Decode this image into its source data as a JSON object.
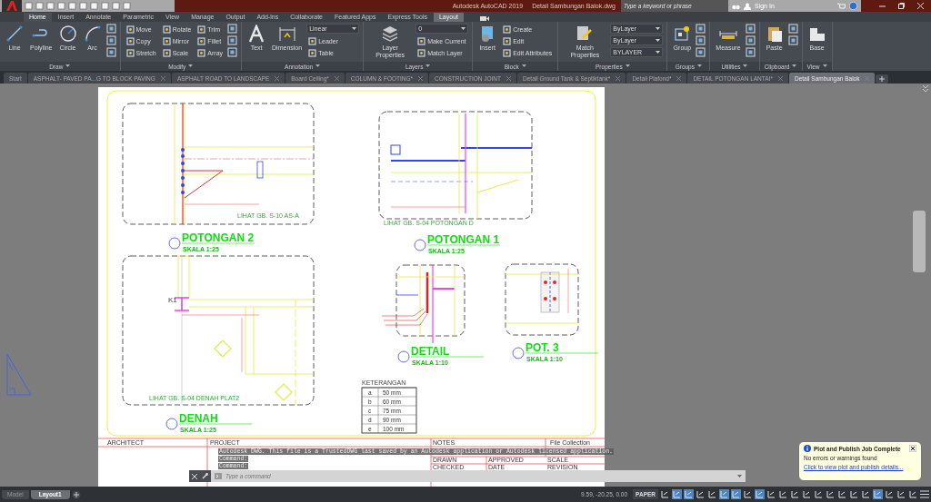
{
  "window": {
    "app_name": "Autodesk AutoCAD 2019",
    "file_name": "Detail Sambungan Balok.dwg"
  },
  "search": {
    "placeholder": "Type a keyword or phrase"
  },
  "account": {
    "label": "Sign In"
  },
  "ribbon_tabs": [
    {
      "label": "Home",
      "selected": true,
      "kind": "normal"
    },
    {
      "label": "Insert",
      "selected": false,
      "kind": "normal"
    },
    {
      "label": "Annotate",
      "selected": false,
      "kind": "normal"
    },
    {
      "label": "Parametric",
      "selected": false,
      "kind": "normal"
    },
    {
      "label": "View",
      "selected": false,
      "kind": "normal"
    },
    {
      "label": "Manage",
      "selected": false,
      "kind": "normal"
    },
    {
      "label": "Output",
      "selected": false,
      "kind": "normal"
    },
    {
      "label": "Add-ins",
      "selected": false,
      "kind": "normal"
    },
    {
      "label": "Collaborate",
      "selected": false,
      "kind": "normal"
    },
    {
      "label": "Featured Apps",
      "selected": false,
      "kind": "normal"
    },
    {
      "label": "Express Tools",
      "selected": false,
      "kind": "normal"
    },
    {
      "label": "Layout",
      "selected": false,
      "kind": "contextual"
    }
  ],
  "panels": [
    {
      "title": "Draw",
      "tools": [
        {
          "kind": "large",
          "label": "Line"
        },
        {
          "kind": "large",
          "label": "Polyline"
        },
        {
          "kind": "large",
          "label": "Circle"
        },
        {
          "kind": "large",
          "label": "Arc"
        },
        {
          "kind": "icon"
        },
        {
          "kind": "icon"
        },
        {
          "kind": "icon"
        }
      ]
    },
    {
      "title": "Modify",
      "tools": [
        {
          "kind": "small",
          "label": "Move"
        },
        {
          "kind": "small",
          "label": "Copy"
        },
        {
          "kind": "small",
          "label": "Stretch"
        },
        {
          "kind": "small",
          "label": "Rotate"
        },
        {
          "kind": "small",
          "label": "Mirror"
        },
        {
          "kind": "small",
          "label": "Scale"
        },
        {
          "kind": "small",
          "label": "Trim"
        },
        {
          "kind": "small",
          "label": "Fillet"
        },
        {
          "kind": "small",
          "label": "Array"
        },
        {
          "kind": "icon"
        },
        {
          "kind": "icon"
        },
        {
          "kind": "icon"
        }
      ]
    },
    {
      "title": "Annotation",
      "tools": [
        {
          "kind": "large",
          "label": "Text"
        },
        {
          "kind": "large",
          "label": "Dimension"
        },
        {
          "kind": "select",
          "label": "Linear"
        },
        {
          "kind": "small",
          "label": "Leader"
        },
        {
          "kind": "small",
          "label": "Table"
        }
      ]
    },
    {
      "title": "Layers",
      "tools": [
        {
          "kind": "large",
          "label": "Layer Properties"
        },
        {
          "kind": "select",
          "label": "0"
        },
        {
          "kind": "small",
          "label": "Make Current"
        },
        {
          "kind": "small",
          "label": "Match Layer"
        }
      ]
    },
    {
      "title": "Block",
      "tools": [
        {
          "kind": "large",
          "label": "Insert"
        },
        {
          "kind": "small",
          "label": "Create"
        },
        {
          "kind": "small",
          "label": "Edit"
        },
        {
          "kind": "small",
          "label": "Edit Attributes"
        }
      ]
    },
    {
      "title": "Properties",
      "tools": [
        {
          "kind": "large",
          "label": "Match Properties"
        },
        {
          "kind": "select",
          "label": "ByLayer"
        },
        {
          "kind": "select",
          "label": "ByLayer"
        },
        {
          "kind": "select",
          "label": "BYLAYER"
        }
      ]
    },
    {
      "title": "Groups",
      "tools": [
        {
          "kind": "large",
          "label": "Group"
        },
        {
          "kind": "icon"
        },
        {
          "kind": "icon"
        },
        {
          "kind": "icon"
        }
      ]
    },
    {
      "title": "Utilities",
      "tools": [
        {
          "kind": "large",
          "label": "Measure"
        },
        {
          "kind": "icon"
        },
        {
          "kind": "icon"
        },
        {
          "kind": "icon"
        }
      ]
    },
    {
      "title": "Clipboard",
      "tools": [
        {
          "kind": "large",
          "label": "Paste"
        },
        {
          "kind": "icon"
        },
        {
          "kind": "icon"
        }
      ]
    },
    {
      "title": "View",
      "tools": [
        {
          "kind": "large",
          "label": "Base"
        }
      ]
    }
  ],
  "file_tabs": [
    {
      "label": "Start",
      "selected": false
    },
    {
      "label": "ASPHALT- PAVED PA...G TO BLOCK PAVING",
      "selected": false
    },
    {
      "label": "ASPHALT ROAD TO LANDSCAPE",
      "selected": false
    },
    {
      "label": "Board Ceiling*",
      "selected": false
    },
    {
      "label": "COLUMN & FOOTING*",
      "selected": false
    },
    {
      "label": "CONSTRUCTION JOINT",
      "selected": false
    },
    {
      "label": "Detail Ground Tank & Septiktank*",
      "selected": false
    },
    {
      "label": "Detail Plafond*",
      "selected": false
    },
    {
      "label": "DETAIL POTONGAN LANTAI*",
      "selected": false
    },
    {
      "label": "Detail Sambungan Balok",
      "selected": true
    }
  ],
  "sheet": {
    "views": [
      {
        "title": "POTONGAN 2",
        "scale": "SKALA 1:25",
        "note": "LIHAT GB. S-10  AS-A"
      },
      {
        "title": "POTONGAN 1",
        "scale": "SKALA 1:25",
        "note": "LIHAT GB. S-04  POTONGAN D"
      },
      {
        "title": "DENAH",
        "scale": "SKALA 1:25",
        "note": "LIHAT GB. S-04  DENAH PLAT2",
        "tag": "K1"
      },
      {
        "title": "DETAIL",
        "scale": "SKALA 1:10"
      },
      {
        "title": "POT. 3",
        "scale": "SKALA 1:10"
      }
    ],
    "legend": {
      "title": "KETERANGAN",
      "rows": [
        [
          "a",
          "50 mm"
        ],
        [
          "b",
          "60 mm"
        ],
        [
          "c",
          "75 mm"
        ],
        [
          "d",
          "90 mm"
        ],
        [
          "e",
          "100 mm"
        ]
      ]
    },
    "title_block": {
      "architect": "ARCHITECT",
      "project": "PROJECT",
      "notes": "NOTES",
      "collection": "File Collection",
      "drawn": "DRAWN",
      "checked": "CHECKED",
      "approved": "APPROVED",
      "date": "DATE",
      "scale": "SCALE",
      "revision": "REVISION"
    }
  },
  "command_line": {
    "history": [
      "Autodesk DWG.  This file is a TrustedDWG last saved by an Autodesk application or Autodesk licensed application.",
      "Command:",
      "Command:"
    ],
    "placeholder": "Type a command"
  },
  "layout_tabs": [
    {
      "label": "Model",
      "selected": false,
      "kind": "model"
    },
    {
      "label": "Layout1",
      "selected": true,
      "kind": "layout"
    }
  ],
  "status_bar": {
    "coordinates": "9.59, -20.25, 0.00",
    "space": "PAPER",
    "toggles": [
      {
        "on": false
      },
      {
        "on": true
      },
      {
        "on": true
      },
      {
        "on": false
      },
      {
        "on": false
      },
      {
        "on": true
      },
      {
        "on": true
      },
      {
        "on": false
      },
      {
        "on": true
      },
      {
        "on": false
      },
      {
        "on": false
      },
      {
        "on": false
      },
      {
        "on": false
      },
      {
        "on": false
      },
      {
        "on": false
      },
      {
        "on": false
      },
      {
        "on": false
      },
      {
        "on": false
      },
      {
        "on": true
      },
      {
        "on": false
      },
      {
        "on": false
      },
      {
        "on": false
      }
    ]
  },
  "notification": {
    "title": "Plot and Publish Job Complete",
    "message": "No errors or warnings found",
    "link": "Click to view plot and publish details..."
  }
}
